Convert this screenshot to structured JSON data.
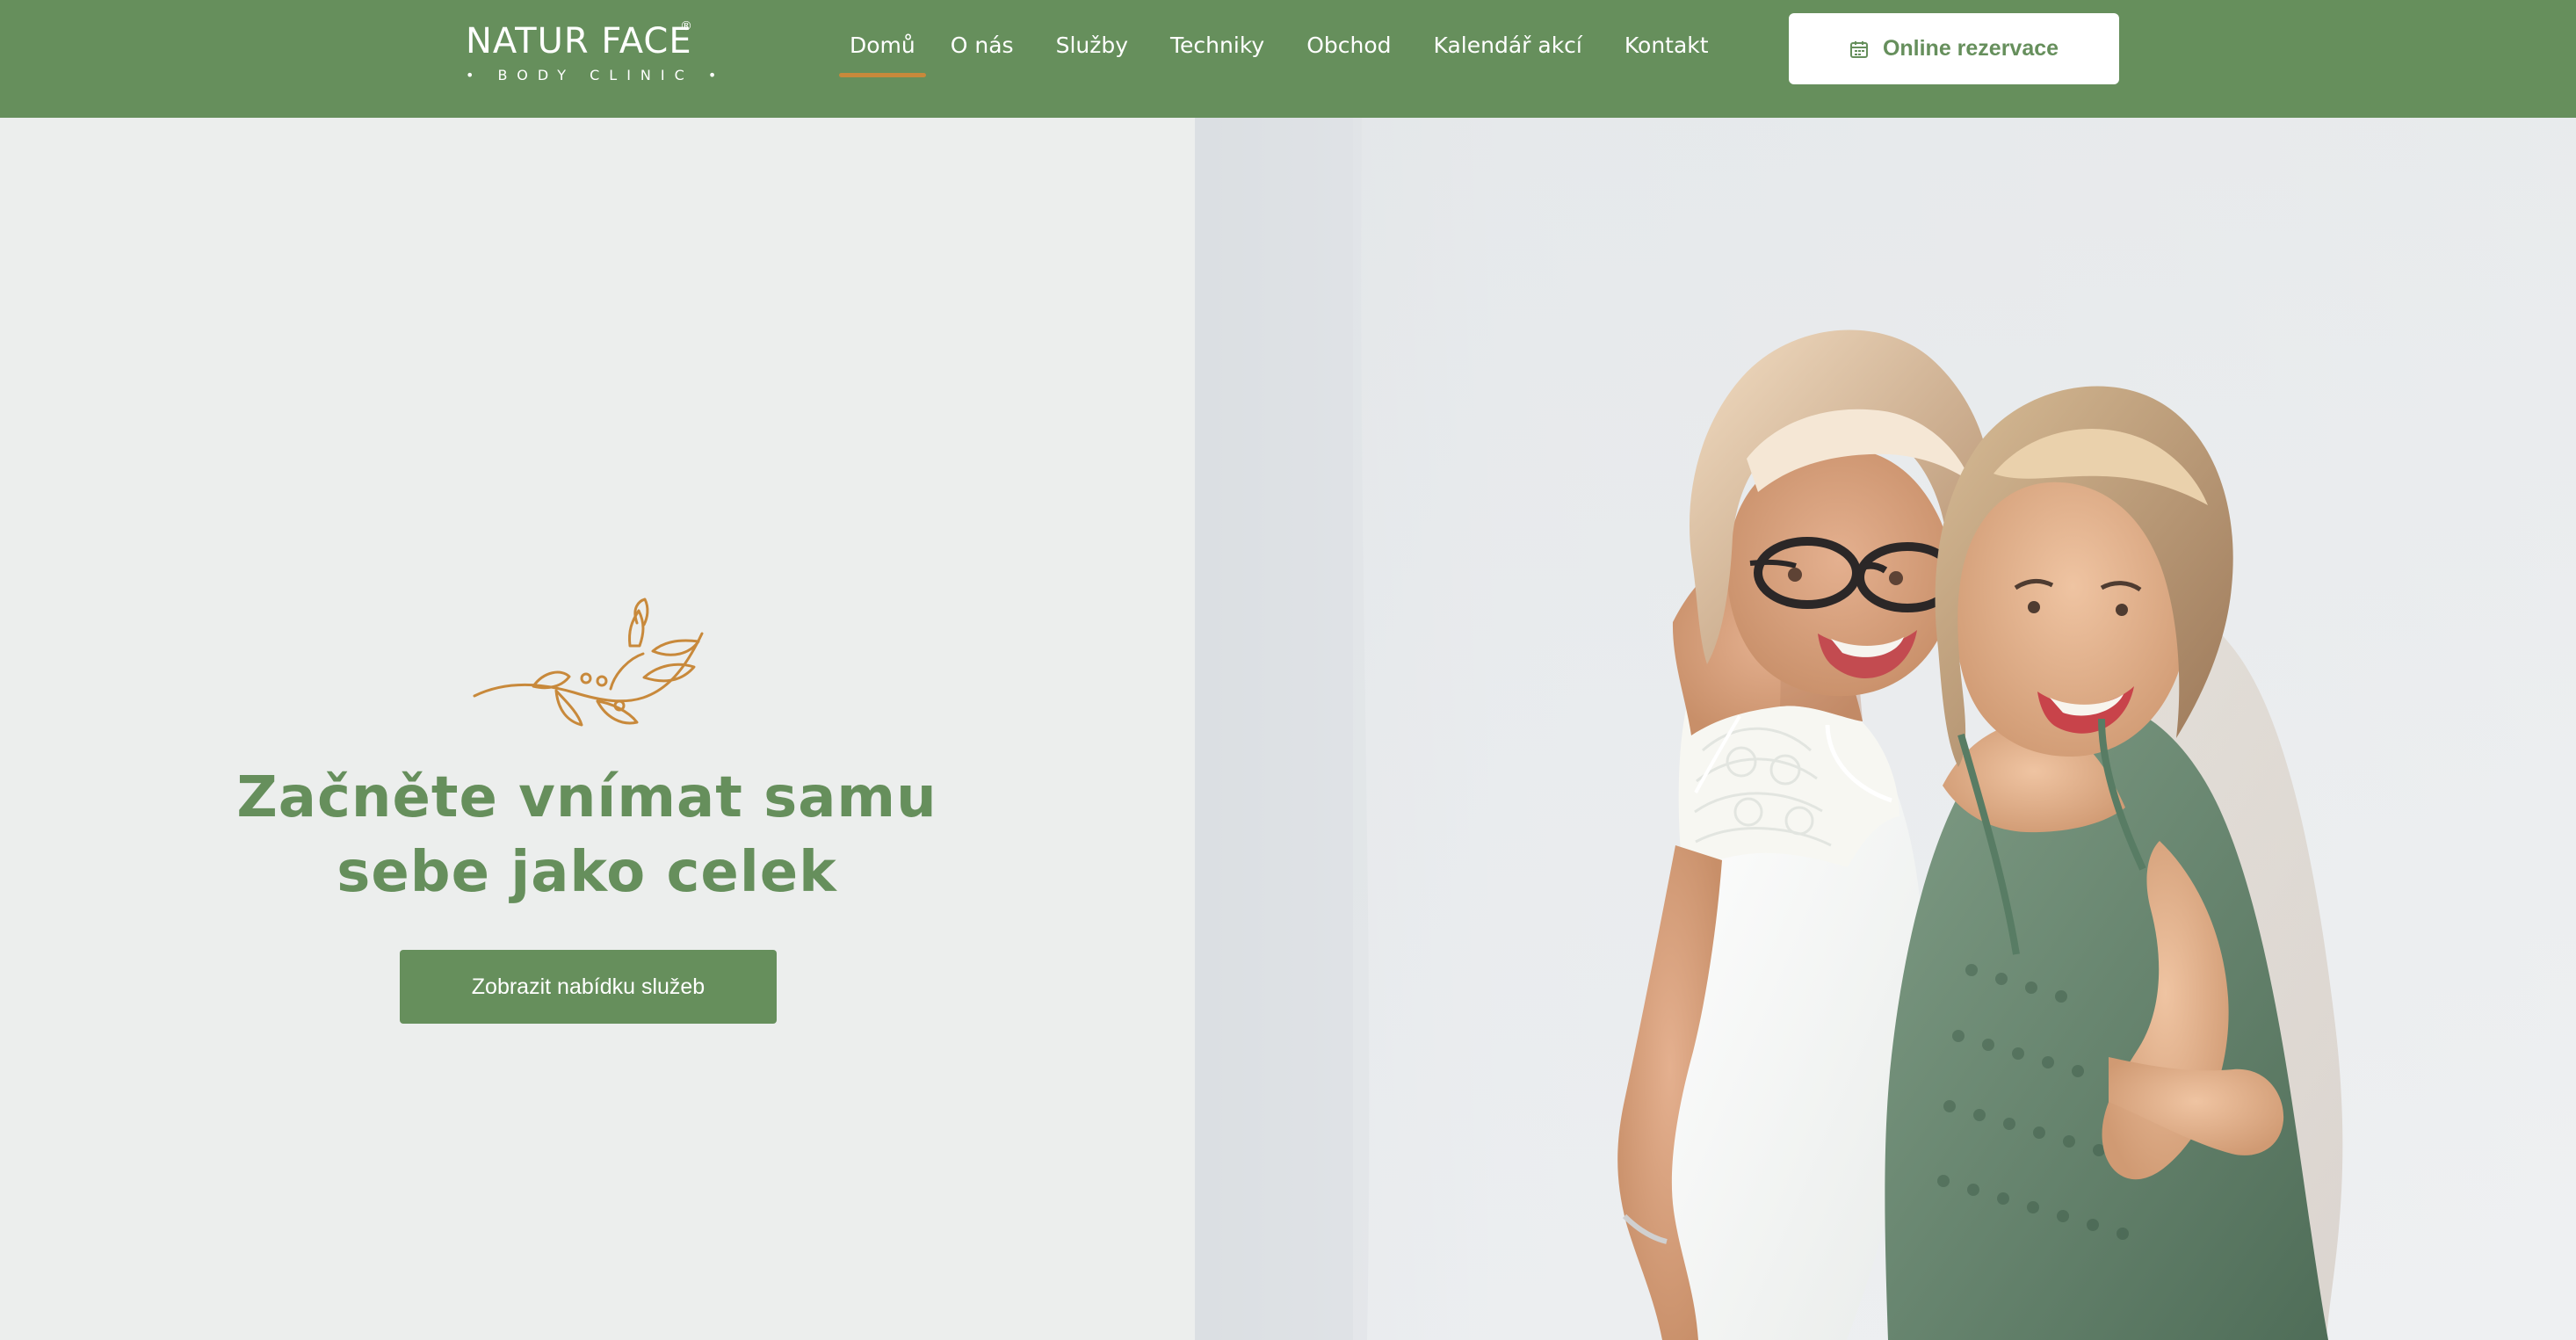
{
  "brand": {
    "name": "NATUR FACE",
    "registered": "®",
    "tagline": "• BODY CLINIC •",
    "logo_color": "#ffffff"
  },
  "colors": {
    "primary": "#668f5c",
    "accent": "#c8893b",
    "background": "#eceeed",
    "white": "#ffffff"
  },
  "nav": {
    "items": [
      {
        "label": "Domů",
        "active": true
      },
      {
        "label": "O nás",
        "active": false
      },
      {
        "label": "Služby",
        "active": false
      },
      {
        "label": "Techniky",
        "active": false
      },
      {
        "label": "Obchod",
        "active": false
      },
      {
        "label": "Kalendář akcí",
        "active": false
      },
      {
        "label": "Kontakt",
        "active": false
      }
    ]
  },
  "header": {
    "reserve_label": "Online rezervace",
    "reserve_icon": "calendar-icon"
  },
  "hero": {
    "ornament_icon": "flower-branch-icon",
    "headline_line1": "Začněte vnímat samu",
    "headline_line2": "sebe jako celek",
    "cta_label": "Zobrazit nabídku služeb",
    "image_alt": "two-women-smiling-photo"
  }
}
